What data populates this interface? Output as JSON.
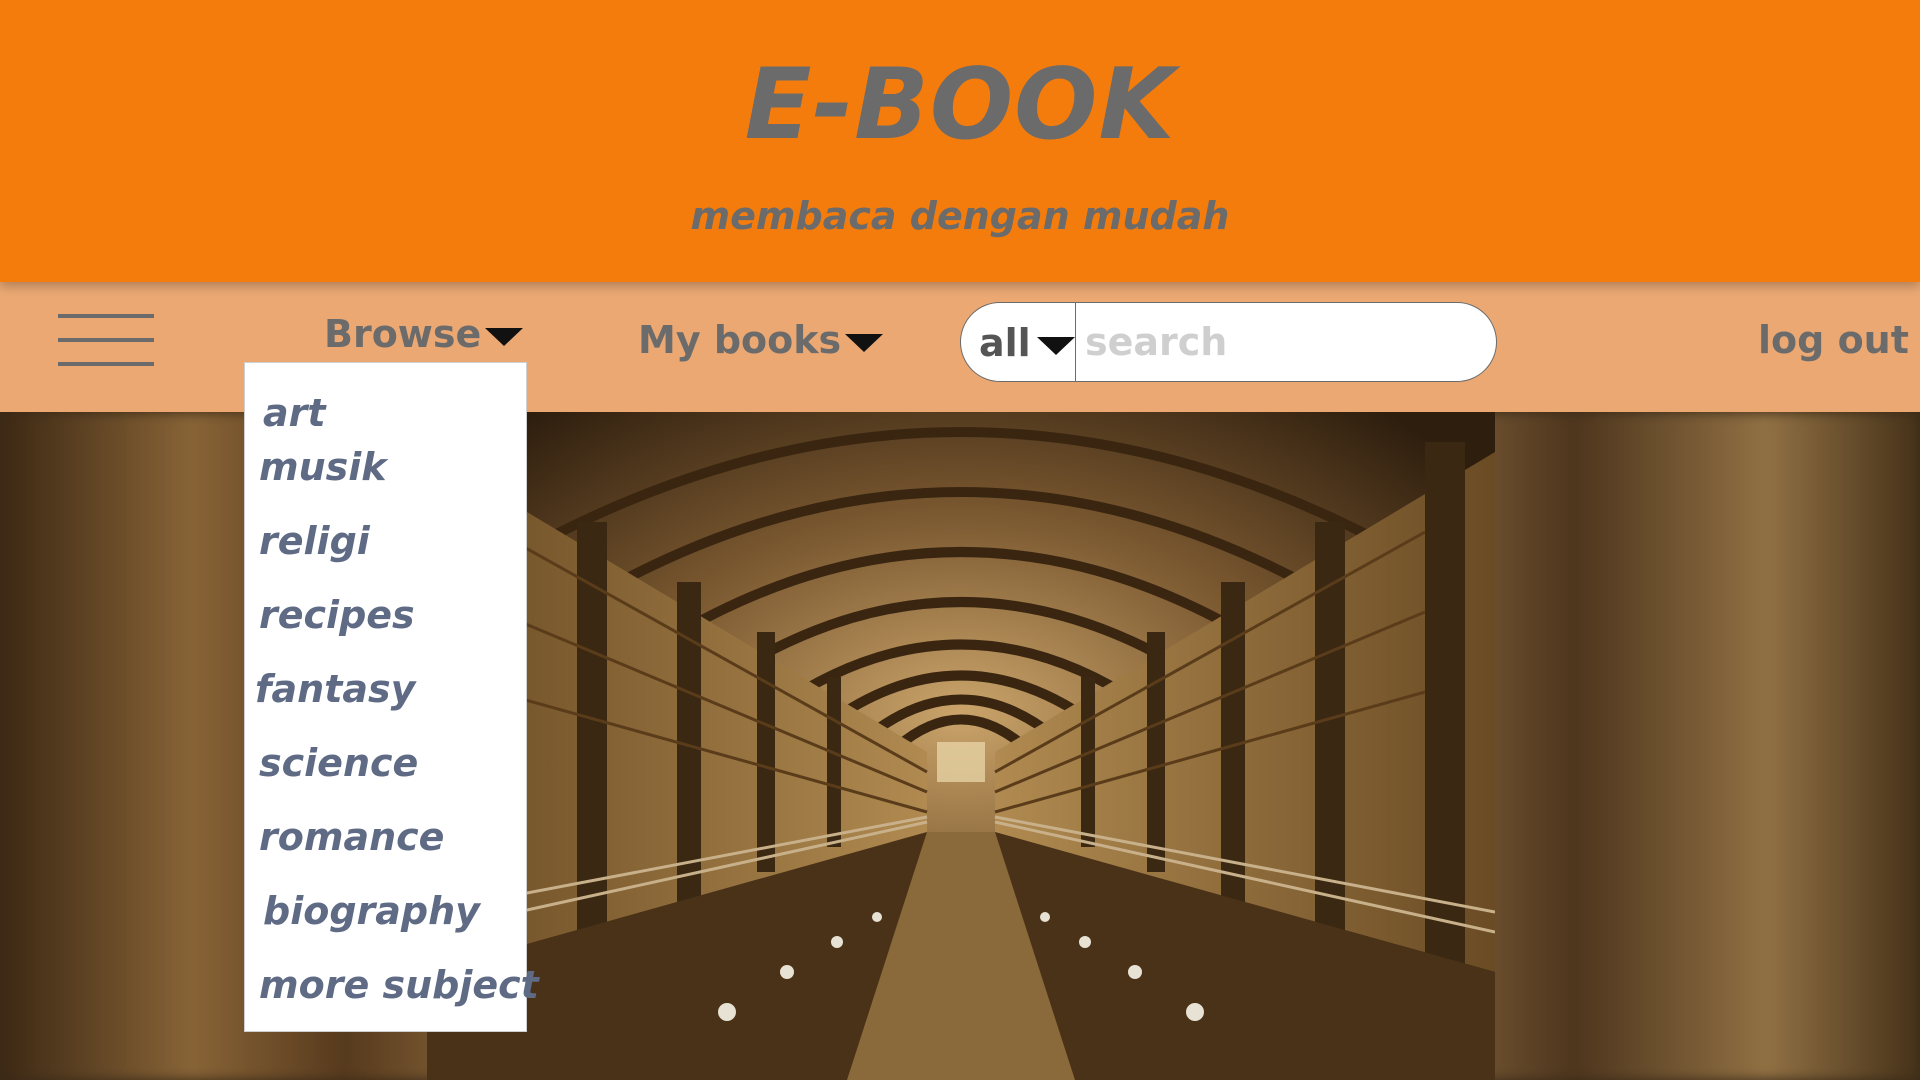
{
  "header": {
    "title": "E-BOOK",
    "tagline": "membaca dengan mudah"
  },
  "nav": {
    "menu_icon": "hamburger-menu-icon",
    "browse_label": "Browse",
    "mybooks_label": "My books",
    "logout_label": "log out",
    "caret_icon": "caret-down-icon"
  },
  "search": {
    "scope_value": "all",
    "placeholder": "search",
    "value": ""
  },
  "browse_menu": {
    "items": [
      "art",
      "musik",
      "religi",
      "recipes",
      "fantasy",
      "science",
      "romance",
      "biography",
      "more subject"
    ]
  },
  "hero": {
    "image_subject": "library-hall-photo"
  },
  "colors": {
    "header_bg": "#f47c0c",
    "navbar_bg": "#eba873",
    "text_gray": "#6b6b6b",
    "menu_text": "#5f6a85"
  }
}
